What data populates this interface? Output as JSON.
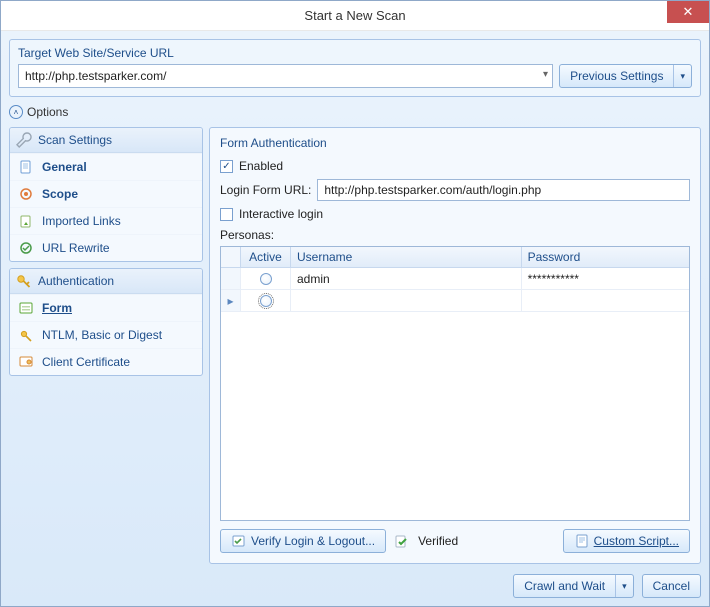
{
  "title": "Start a New Scan",
  "target_group": {
    "title": "Target Web Site/Service URL",
    "url": "http://php.testsparker.com/",
    "previous_settings": "Previous Settings"
  },
  "options_label": "Options",
  "sidebar": {
    "scan_settings": {
      "title": "Scan Settings",
      "items": [
        "General",
        "Scope",
        "Imported Links",
        "URL Rewrite"
      ]
    },
    "authentication": {
      "title": "Authentication",
      "items": [
        "Form",
        "NTLM, Basic or Digest",
        "Client Certificate"
      ]
    }
  },
  "main": {
    "title": "Form Authentication",
    "enabled_label": "Enabled",
    "login_form_label": "Login Form URL:",
    "login_form_url": "http://php.testsparker.com/auth/login.php",
    "interactive_label": "Interactive login",
    "personas_label": "Personas:",
    "grid": {
      "headers": [
        "Active",
        "Username",
        "Password"
      ],
      "rows": [
        {
          "active": false,
          "username": "admin",
          "password": "***********"
        },
        {
          "active": false,
          "username": "",
          "password": ""
        }
      ]
    },
    "verify_button": "Verify Login & Logout...",
    "verified_label": "Verified",
    "custom_script_button": "Custom Script..."
  },
  "footer": {
    "crawl": "Crawl and Wait",
    "cancel": "Cancel"
  }
}
